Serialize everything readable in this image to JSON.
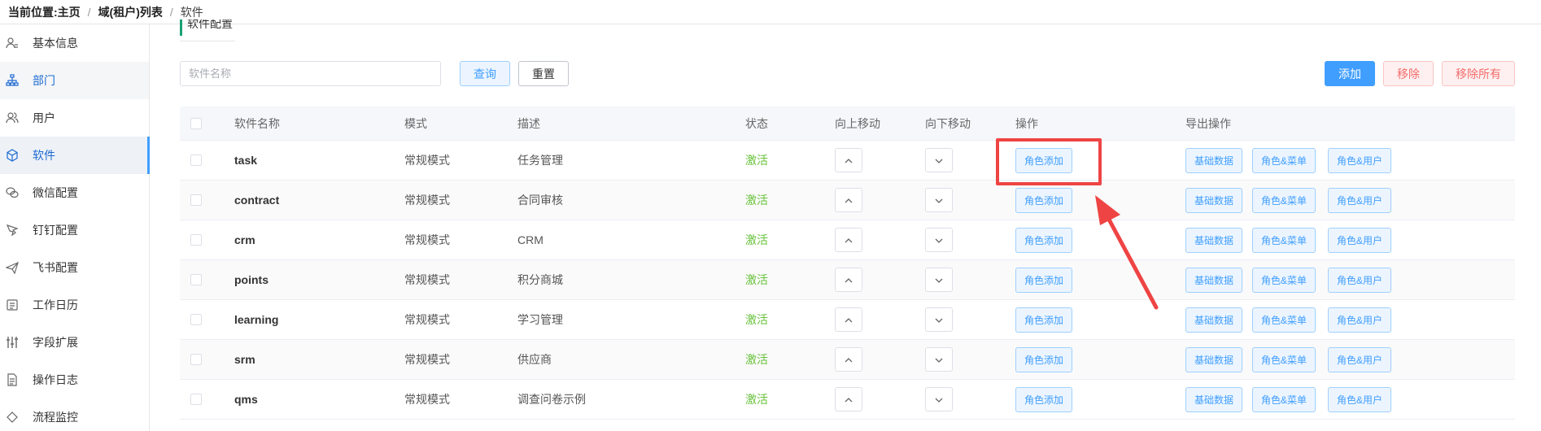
{
  "breadcrumb": {
    "prefix": "当前位置:",
    "items": [
      "主页",
      "域(租户)列表",
      "软件"
    ],
    "separator": "/"
  },
  "sidebar": {
    "items": [
      {
        "label": "基本信息",
        "icon": "user-info-icon"
      },
      {
        "label": "部门",
        "icon": "org-chart-icon"
      },
      {
        "label": "用户",
        "icon": "users-icon"
      },
      {
        "label": "软件",
        "icon": "cube-icon"
      },
      {
        "label": "微信配置",
        "icon": "wechat-icon"
      },
      {
        "label": "钉钉配置",
        "icon": "dingtalk-icon"
      },
      {
        "label": "飞书配置",
        "icon": "feishu-icon"
      },
      {
        "label": "工作日历",
        "icon": "calendar-icon"
      },
      {
        "label": "字段扩展",
        "icon": "sliders-icon"
      },
      {
        "label": "操作日志",
        "icon": "log-icon"
      },
      {
        "label": "流程监控",
        "icon": "flow-monitor-icon"
      }
    ],
    "active_index": 3,
    "hover_index": 1
  },
  "section": {
    "title": "软件配置"
  },
  "search": {
    "placeholder": "软件名称",
    "value": ""
  },
  "toolbar": {
    "query_label": "查询",
    "reset_label": "重置",
    "add_label": "添加",
    "remove_label": "移除",
    "remove_all_label": "移除所有"
  },
  "table": {
    "headers": {
      "name": "软件名称",
      "mode": "模式",
      "desc": "描述",
      "status": "状态",
      "move_up": "向上移动",
      "move_down": "向下移动",
      "operation": "操作",
      "export": "导出操作"
    },
    "row_buttons": {
      "role_add": "角色添加",
      "basic_data": "基础数据",
      "role_menu": "角色&菜单",
      "role_user": "角色&用户"
    },
    "rows": [
      {
        "name": "task",
        "mode": "常规模式",
        "desc": "任务管理",
        "status": "激活"
      },
      {
        "name": "contract",
        "mode": "常规模式",
        "desc": "合同审核",
        "status": "激活"
      },
      {
        "name": "crm",
        "mode": "常规模式",
        "desc": "CRM",
        "status": "激活"
      },
      {
        "name": "points",
        "mode": "常规模式",
        "desc": "积分商城",
        "status": "激活"
      },
      {
        "name": "learning",
        "mode": "常规模式",
        "desc": "学习管理",
        "status": "激活"
      },
      {
        "name": "srm",
        "mode": "常规模式",
        "desc": "供应商",
        "status": "激活"
      },
      {
        "name": "qms",
        "mode": "常规模式",
        "desc": "调查问卷示例",
        "status": "激活"
      }
    ]
  },
  "colors": {
    "primary": "#409eff",
    "danger": "#f56c6c",
    "success": "#67c23a",
    "annotation": "#ef4444"
  }
}
